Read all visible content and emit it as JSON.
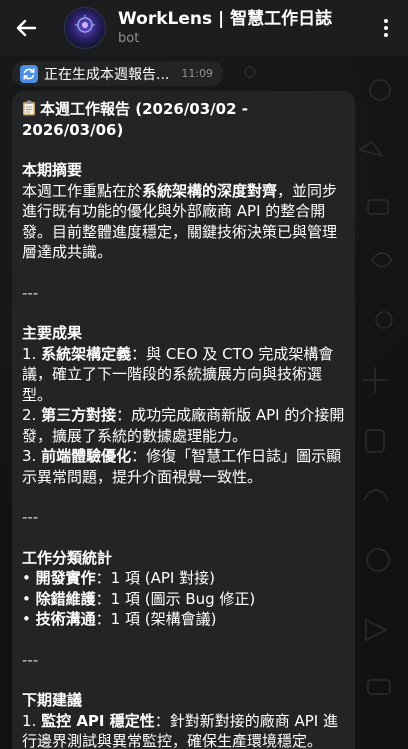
{
  "header": {
    "title": "WorkLens | 智慧工作日誌",
    "subtitle": "bot",
    "avatar_text": "WORKLENS AI"
  },
  "status": {
    "text": "正在生成本週報告...",
    "time": "11:09"
  },
  "report": {
    "title": "本週工作報告 (2026/03/02 - 2026/03/06)",
    "separator": "---",
    "summary": {
      "heading": "本期摘要",
      "pre": "本週工作重點在於",
      "bold": "系統架構的深度對齊",
      "post": "，並同步進行既有功能的優化與外部廠商 API 的整合開發。目前整體進度穩定，關鍵技術決策已與管理層達成共識。"
    },
    "achievements": {
      "heading": "主要成果",
      "items": [
        {
          "num": "1. ",
          "bold": "系統架構定義",
          "text": "：與 CEO 及 CTO 完成架構會議，確立了下一階段的系統擴展方向與技術選型。"
        },
        {
          "num": "2. ",
          "bold": "第三方對接",
          "text": "：成功完成廠商新版 API 的介接開發，擴展了系統的數據處理能力。"
        },
        {
          "num": "3. ",
          "bold": "前端體驗優化",
          "text": "：修復「智慧工作日誌」圖示顯示異常問題，提升介面視覺一致性。"
        }
      ]
    },
    "stats": {
      "heading": "工作分類統計",
      "items": [
        {
          "bullet": "• ",
          "bold": "開發實作",
          "text": "：1 項 (API 對接)"
        },
        {
          "bullet": "• ",
          "bold": "除錯維護",
          "text": "：1 項 (圖示 Bug 修正)"
        },
        {
          "bullet": "• ",
          "bold": "技術溝通",
          "text": "：1 項 (架構會議)"
        }
      ]
    },
    "next": {
      "heading": "下期建議",
      "items": [
        {
          "num": "1. ",
          "bold": "監控 API 穩定性",
          "text": "：針對新對接的廠商 API 進行邊界測試與異常監控，確保生產環境穩定。"
        }
      ]
    }
  }
}
